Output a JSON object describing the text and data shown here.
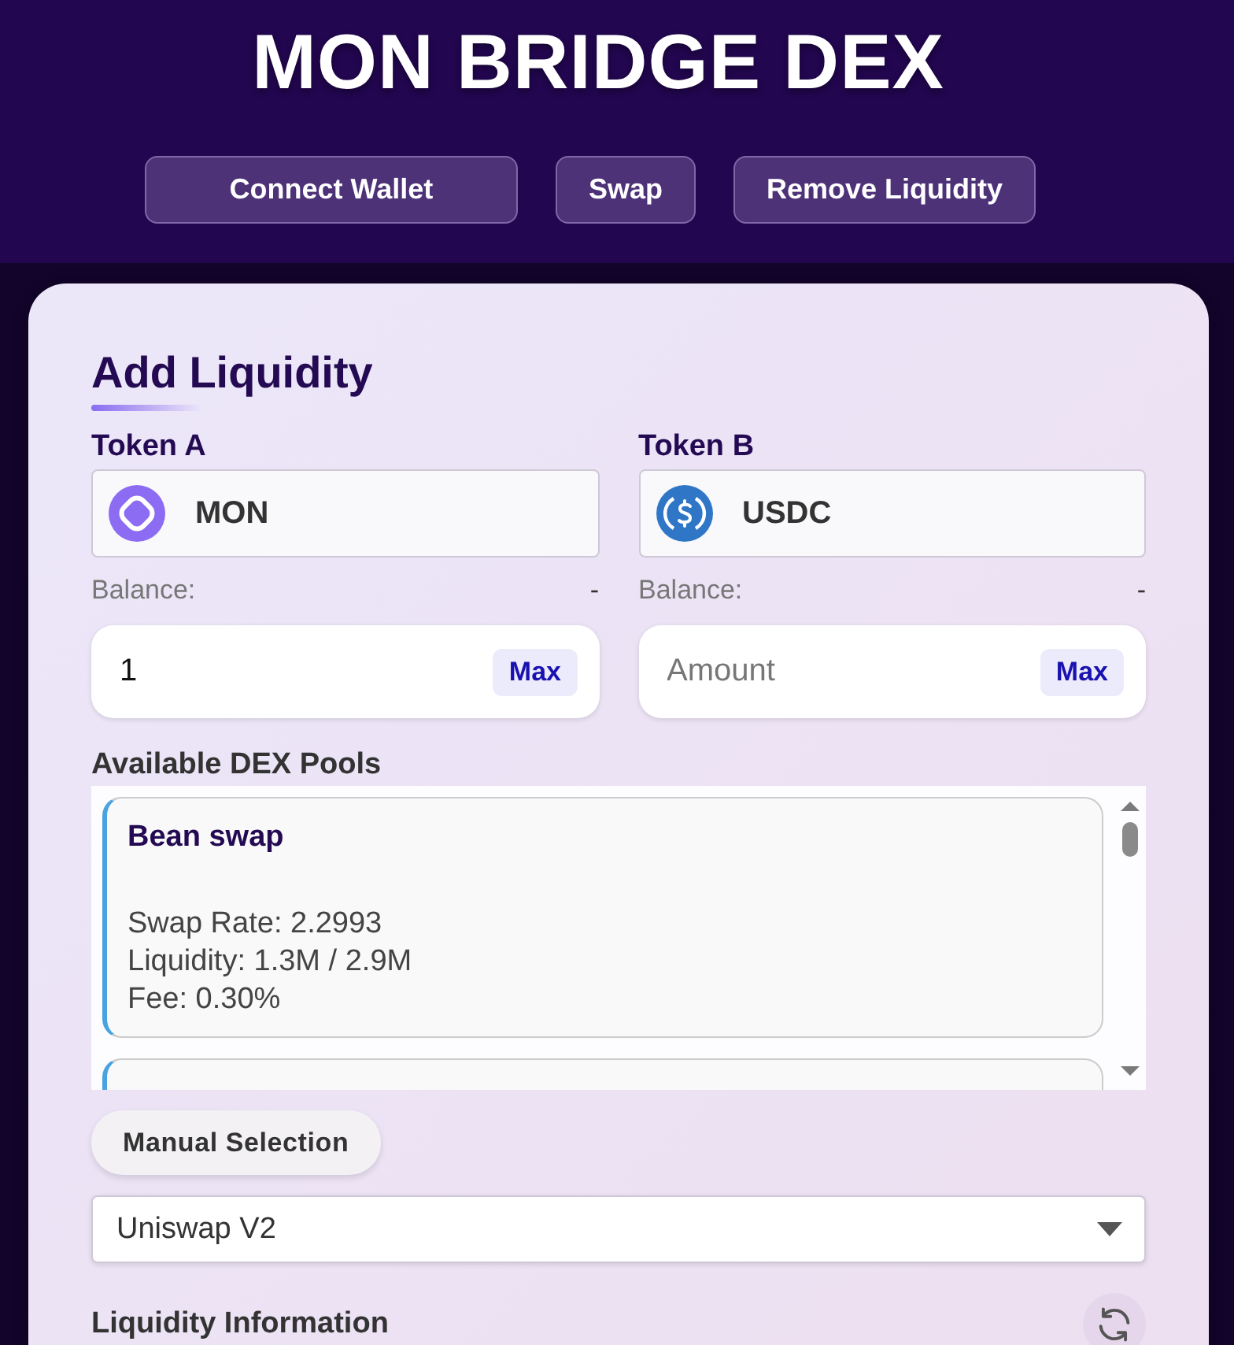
{
  "header": {
    "title": "MON BRIDGE DEX",
    "nav_buttons": [
      "Connect Wallet",
      "Swap",
      "Remove Liquidity"
    ]
  },
  "panel": {
    "title": "Add Liquidity",
    "tokens": [
      {
        "label": "Token A",
        "kind": "mon",
        "symbol": "MON",
        "balance_label": "Balance:",
        "balance": "-",
        "amount": {
          "value": "1"
        },
        "max_button": "Max"
      },
      {
        "label": "Token B",
        "kind": "usdc",
        "symbol": "USDC",
        "balance_label": "Balance:",
        "balance": "-",
        "amount": {
          "placeholder": "Amount"
        },
        "max_button": "Max"
      }
    ],
    "pools": {
      "title": "Available DEX Pools",
      "items": [
        {
          "name": "Bean swap",
          "details": [
            "Swap Rate: 2.2993",
            "Liquidity: 1.3M / 2.9M",
            "Fee: 0.30%"
          ]
        }
      ],
      "more_below": true
    },
    "manual_selection_button": "Manual Selection",
    "dex_select": {
      "value": "Uniswap V2"
    },
    "liquidity_info": {
      "title": "Liquidity Information"
    }
  }
}
